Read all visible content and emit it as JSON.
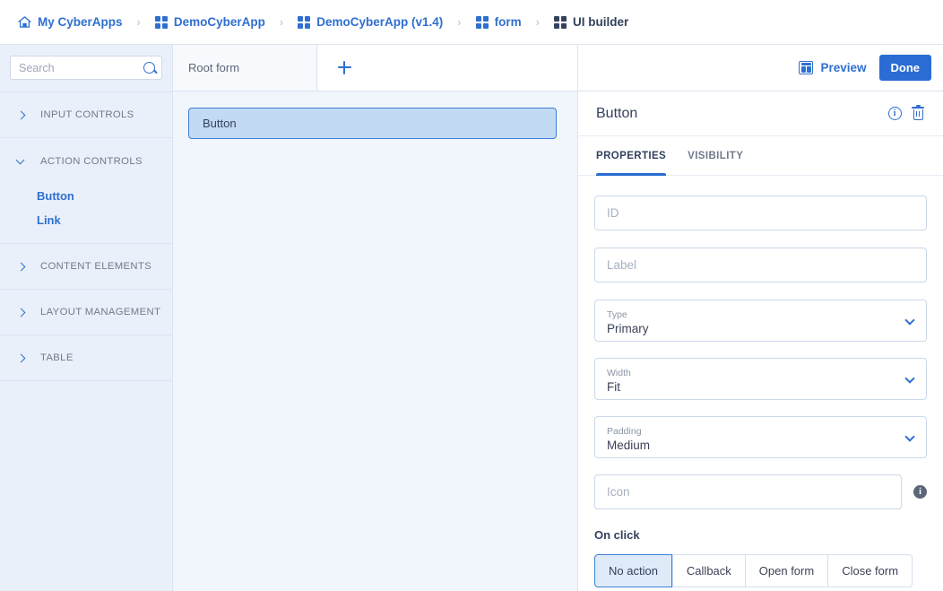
{
  "breadcrumb": {
    "items": [
      {
        "label": "My CyberApps",
        "icon": "home-icon",
        "current": false
      },
      {
        "label": "DemoCyberApp",
        "icon": "grid-icon",
        "current": false
      },
      {
        "label": "DemoCyberApp (v1.4)",
        "icon": "grid-icon",
        "current": false
      },
      {
        "label": "form",
        "icon": "grid-icon",
        "current": false
      },
      {
        "label": "UI builder",
        "icon": "grid-icon",
        "current": true
      }
    ],
    "separator": "›"
  },
  "sidebar": {
    "search": {
      "value": "",
      "placeholder": "Search",
      "icon": "search-icon"
    },
    "sections": [
      {
        "label": "INPUT CONTROLS",
        "expanded": false,
        "items": []
      },
      {
        "label": "ACTION CONTROLS",
        "expanded": true,
        "items": [
          "Button",
          "Link"
        ]
      },
      {
        "label": "CONTENT ELEMENTS",
        "expanded": false,
        "items": []
      },
      {
        "label": "LAYOUT MANAGEMENT",
        "expanded": false,
        "items": []
      },
      {
        "label": "TABLE",
        "expanded": false,
        "items": []
      }
    ]
  },
  "canvas": {
    "tab_label": "Root form",
    "add_tab_icon": "plus-icon",
    "elements": [
      {
        "label": "Button",
        "selected": true
      }
    ]
  },
  "properties_panel": {
    "preview_label": "Preview",
    "preview_icon": "dashboard-icon",
    "done_label": "Done",
    "title": "Button",
    "info_icon": "info-icon",
    "delete_icon": "trash-icon",
    "tabs": [
      {
        "label": "PROPERTIES",
        "active": true
      },
      {
        "label": "VISIBILITY",
        "active": false
      }
    ],
    "fields": {
      "id": {
        "value": "",
        "placeholder": "ID"
      },
      "label": {
        "value": "",
        "placeholder": "Label"
      },
      "type": {
        "label": "Type",
        "value": "Primary"
      },
      "width": {
        "label": "Width",
        "value": "Fit"
      },
      "padding": {
        "label": "Padding",
        "value": "Medium"
      },
      "icon": {
        "value": "",
        "placeholder": "Icon",
        "hint_icon": "info-icon"
      }
    },
    "on_click": {
      "label": "On click",
      "options": [
        "No action",
        "Callback",
        "Open form",
        "Close form"
      ],
      "selected": "No action"
    }
  },
  "colors": {
    "accent": "#2f6fd0",
    "primary_button": "#2b6cd4",
    "selection_fill": "#c3daf5",
    "sidebar_bg": "#eaf0fa",
    "canvas_bg": "#f1f5fc"
  }
}
